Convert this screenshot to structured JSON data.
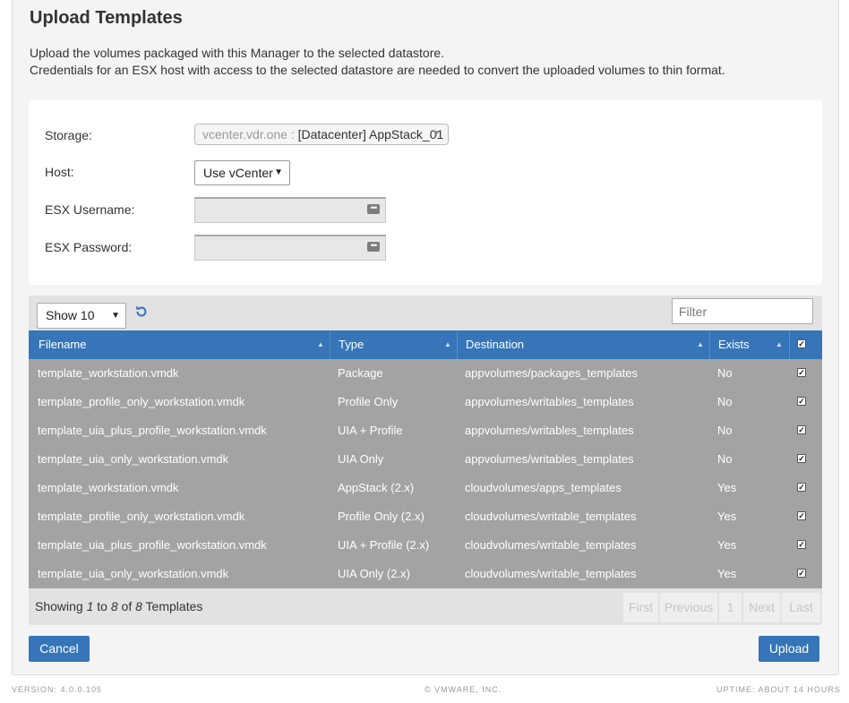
{
  "page": {
    "title": "Upload Templates",
    "description_line1": "Upload the volumes packaged with this Manager to the selected datastore.",
    "description_line2": "Credentials for an ESX host with access to the selected datastore are needed to convert the uploaded volumes to thin format."
  },
  "form": {
    "storage_label": "Storage:",
    "storage_host": "vcenter.vdr.one :",
    "storage_value": "[Datacenter] AppStack_01",
    "host_label": "Host:",
    "host_value": "Use vCenter",
    "username_label": "ESX Username:",
    "password_label": "ESX Password:",
    "username_value": "",
    "password_value": ""
  },
  "table": {
    "show_value": "Show 10",
    "filter_placeholder": "Filter",
    "columns": {
      "filename": "Filename",
      "type": "Type",
      "destination": "Destination",
      "exists": "Exists"
    },
    "rows": [
      {
        "filename": "template_workstation.vmdk",
        "type": "Package",
        "destination": "appvolumes/packages_templates",
        "exists": "No",
        "checked": true
      },
      {
        "filename": "template_profile_only_workstation.vmdk",
        "type": "Profile Only",
        "destination": "appvolumes/writables_templates",
        "exists": "No",
        "checked": true
      },
      {
        "filename": "template_uia_plus_profile_workstation.vmdk",
        "type": "UIA + Profile",
        "destination": "appvolumes/writables_templates",
        "exists": "No",
        "checked": true
      },
      {
        "filename": "template_uia_only_workstation.vmdk",
        "type": "UIA Only",
        "destination": "appvolumes/writables_templates",
        "exists": "No",
        "checked": true
      },
      {
        "filename": "template_workstation.vmdk",
        "type": "AppStack (2.x)",
        "destination": "cloudvolumes/apps_templates",
        "exists": "Yes",
        "checked": true
      },
      {
        "filename": "template_profile_only_workstation.vmdk",
        "type": "Profile Only (2.x)",
        "destination": "cloudvolumes/writable_templates",
        "exists": "Yes",
        "checked": true
      },
      {
        "filename": "template_uia_plus_profile_workstation.vmdk",
        "type": "UIA + Profile (2.x)",
        "destination": "cloudvolumes/writable_templates",
        "exists": "Yes",
        "checked": true
      },
      {
        "filename": "template_uia_only_workstation.vmdk",
        "type": "UIA Only (2.x)",
        "destination": "cloudvolumes/writable_templates",
        "exists": "Yes",
        "checked": true
      }
    ],
    "footer": {
      "showing_prefix": "Showing ",
      "from": "1",
      "to_word": " to ",
      "to": "8",
      "of_word": " of ",
      "total": "8",
      "suffix": " Templates"
    },
    "pager": {
      "first": "First",
      "previous": "Previous",
      "page": "1",
      "next": "Next",
      "last": "Last"
    }
  },
  "actions": {
    "cancel": "Cancel",
    "upload": "Upload"
  },
  "footer": {
    "version": "VERSION: 4.0.0.105",
    "copyright": "© VMWARE, INC.",
    "uptime": "UPTIME: ABOUT 14 HOURS"
  },
  "colors": {
    "accent": "#3575b8",
    "row_bg": "#a3a3a3"
  },
  "icons": {
    "refresh": "refresh-icon",
    "key": "key-icon",
    "sort": "sort-asc-icon"
  }
}
